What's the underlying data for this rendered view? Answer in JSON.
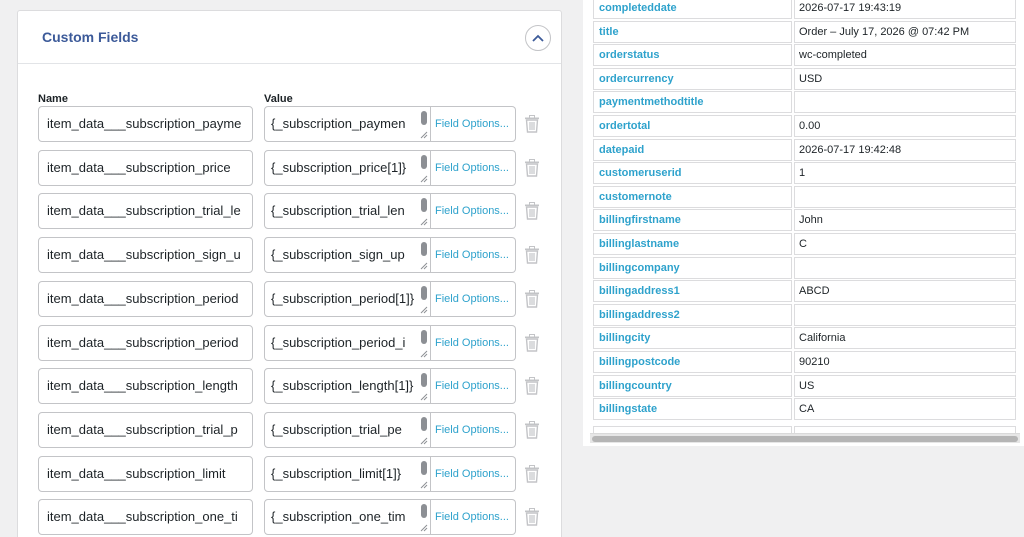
{
  "custom_fields": {
    "title": "Custom Fields",
    "name_header": "Name",
    "value_header": "Value",
    "rows": [
      {
        "name": "item_data___subscription_payme",
        "value": "{_subscription_paymen",
        "options": "Field Options..."
      },
      {
        "name": "item_data___subscription_price",
        "value": "{_subscription_price[1]}",
        "options": "Field Options..."
      },
      {
        "name": "item_data___subscription_trial_le",
        "value": "{_subscription_trial_len",
        "options": "Field Options..."
      },
      {
        "name": "item_data___subscription_sign_u",
        "value": "{_subscription_sign_up",
        "options": "Field Options..."
      },
      {
        "name": "item_data___subscription_period",
        "value": "{_subscription_period[1]}",
        "options": "Field Options..."
      },
      {
        "name": "item_data___subscription_period",
        "value": "{_subscription_period_i",
        "options": "Field Options..."
      },
      {
        "name": "item_data___subscription_length",
        "value": "{_subscription_length[1]}",
        "options": "Field Options..."
      },
      {
        "name": "item_data___subscription_trial_p",
        "value": "{_subscription_trial_pe",
        "options": "Field Options..."
      },
      {
        "name": "item_data___subscription_limit",
        "value": "{_subscription_limit[1]}",
        "options": "Field Options..."
      },
      {
        "name": "item_data___subscription_one_ti",
        "value": "{_subscription_one_tim",
        "options": "Field Options..."
      }
    ]
  },
  "record_table": {
    "rows": [
      {
        "key": "completeddate",
        "value": "2026-07-17 19:43:19"
      },
      {
        "key": "title",
        "value": "Order – July 17, 2026 @ 07:42 PM"
      },
      {
        "key": "orderstatus",
        "value": "wc-completed"
      },
      {
        "key": "ordercurrency",
        "value": "USD"
      },
      {
        "key": "paymentmethodtitle",
        "value": ""
      },
      {
        "key": "ordertotal",
        "value": "0.00"
      },
      {
        "key": "datepaid",
        "value": "2026-07-17 19:42:48"
      },
      {
        "key": "customeruserid",
        "value": "1"
      },
      {
        "key": "customernote",
        "value": ""
      },
      {
        "key": "billingfirstname",
        "value": "John"
      },
      {
        "key": "billinglastname",
        "value": "C"
      },
      {
        "key": "billingcompany",
        "value": ""
      },
      {
        "key": "billingaddress1",
        "value": "ABCD"
      },
      {
        "key": "billingaddress2",
        "value": ""
      },
      {
        "key": "billingcity",
        "value": "California"
      },
      {
        "key": "billingpostcode",
        "value": "90210"
      },
      {
        "key": "billingcountry",
        "value": "US"
      },
      {
        "key": "billingstate",
        "value": "CA"
      }
    ]
  },
  "colors": {
    "title": "#3c5a99",
    "link": "#2ea2cc"
  },
  "icons": {
    "toggle": "chevron-up-icon",
    "delete": "trash-icon",
    "resize": "resize-grip-icon"
  }
}
